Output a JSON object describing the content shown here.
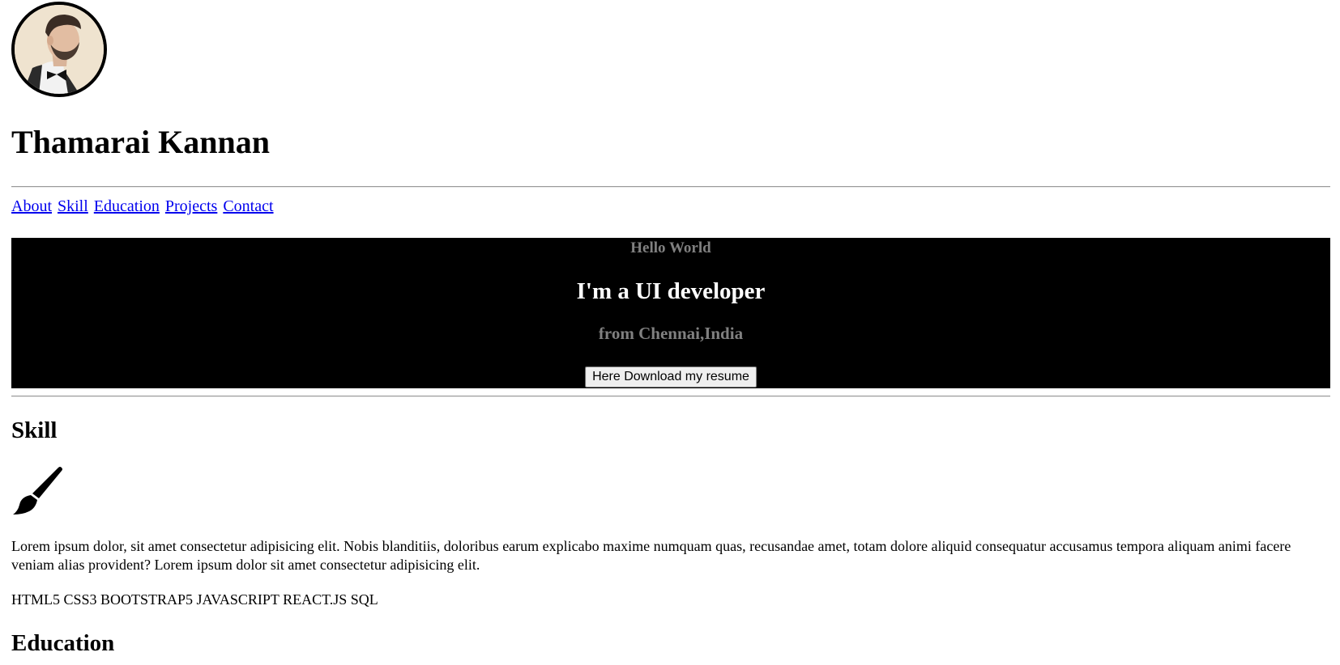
{
  "profile": {
    "name": "Thamarai Kannan",
    "avatar_icon": "profile-photo"
  },
  "nav": {
    "items": [
      {
        "label": "About"
      },
      {
        "label": "Skill"
      },
      {
        "label": "Education"
      },
      {
        "label": "Projects"
      },
      {
        "label": "Contact"
      }
    ]
  },
  "hero": {
    "greeting": "Hello World",
    "title": "I'm a UI developer",
    "location": "from Chennai,India",
    "button_label": "Here Download my resume"
  },
  "skill": {
    "heading": "Skill",
    "icon": "paintbrush-icon",
    "description": "Lorem ipsum dolor, sit amet consectetur adipisicing elit. Nobis blanditiis, doloribus earum explicabo maxime numquam quas, recusandae amet, totam dolore aliquid consequatur accusamus tempora aliquam animi facere veniam alias provident? Lorem ipsum dolor sit amet consectetur adipisicing elit.",
    "list": "HTML5 CSS3 BOOTSTRAP5 JAVASCRIPT REACT.JS SQL"
  },
  "education": {
    "heading": "Education"
  },
  "colors": {
    "hero_background": "#000000",
    "hero_muted_text": "#808080",
    "link": "#0000ee"
  }
}
